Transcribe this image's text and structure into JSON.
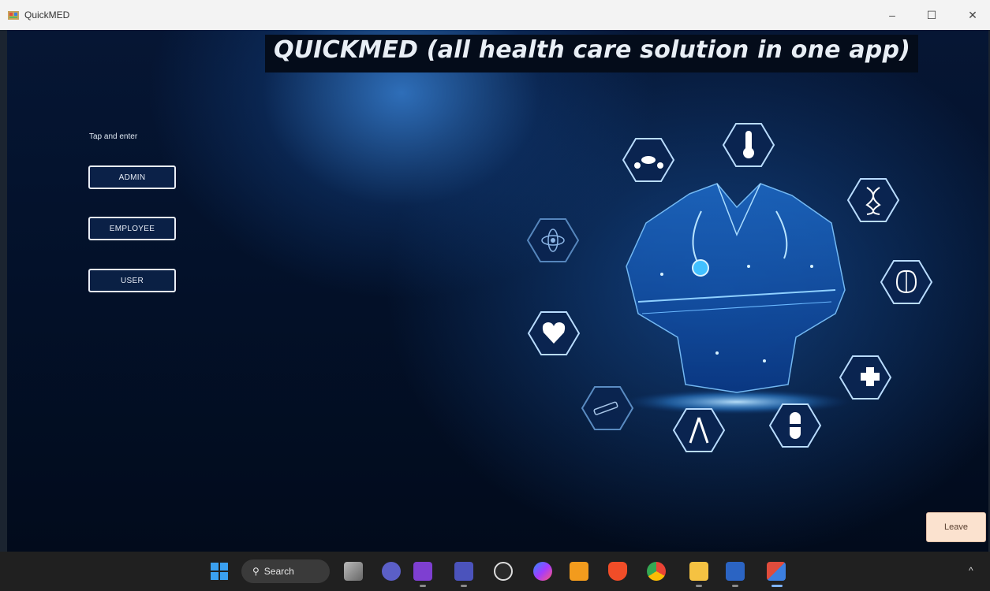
{
  "window": {
    "title": "QuickMED",
    "controls": {
      "minimize": "–",
      "maximize": "☐",
      "close": "✕"
    }
  },
  "main": {
    "heading": "QUICKMED (all health care solution in one app)",
    "prompt": "Tap and enter",
    "buttons": {
      "admin": "ADMIN",
      "employee": "EMPLOYEE",
      "user": "USER"
    },
    "leave": "Leave"
  },
  "illustration_icons": [
    "pills-icon",
    "thermometer-icon",
    "dna-icon",
    "atom-icon",
    "brain-icon",
    "heart-icon",
    "medical-cross-icon",
    "syringe-icon",
    "tweezers-icon",
    "capsule-icon",
    "doctor-figure"
  ],
  "taskbar": {
    "search_label": "Search",
    "apps": [
      "start-icon",
      "task-view-icon",
      "chat-icon",
      "visual-studio-icon",
      "teams-icon",
      "github-desktop-icon",
      "messenger-icon",
      "sublime-icon",
      "brave-icon",
      "chrome-icon",
      "file-explorer-icon",
      "word-icon",
      "quickmed-taskbar-icon"
    ],
    "tray_chevron": "^"
  },
  "colors": {
    "accent": "#1e88e5",
    "background": "#020b1c",
    "title_bar": "#f3f3f3",
    "leave_button": "#fbe2cf"
  }
}
